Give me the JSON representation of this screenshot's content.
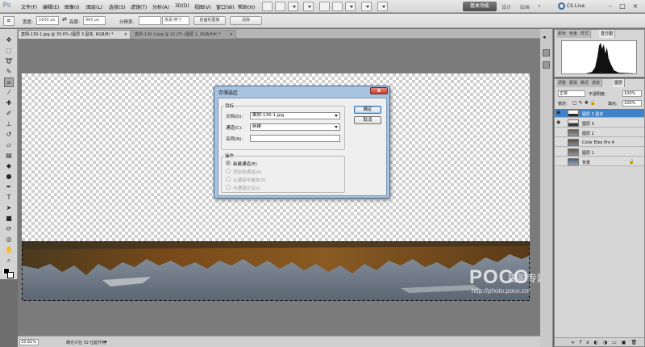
{
  "menubar": {
    "logo": "Ps",
    "items": [
      "文件(F)",
      "编辑(E)",
      "图像(I)",
      "图层(L)",
      "选择(S)",
      "滤镜(T)",
      "分析(A)",
      "3D(D)",
      "视图(V)",
      "窗口(W)",
      "帮助(H)"
    ],
    "workspace": {
      "active": "基本功能",
      "others": [
        "设计",
        "绘画"
      ]
    },
    "cs_live": "CS Live"
  },
  "options": {
    "width_label": "宽度:",
    "width_value": "1600 px",
    "height_label": "高度:",
    "height_value": "860 px",
    "resolution_label": "分辨率:",
    "unit_value": "像素/英寸",
    "front_image_button": "前面的图像",
    "clear_button": "清除"
  },
  "tabs": [
    {
      "label": "案例-130-1.jpg @ 33.6% (图层 3 副本, RGB/8) *",
      "close": "×",
      "active": true
    },
    {
      "label": "案例-130-2.jpg @ 22.2% (图层 1, RGB/8#) *",
      "close": "×",
      "active": false
    }
  ],
  "dialog": {
    "title": "存储选区",
    "close": "x",
    "target_group": "目标",
    "document_label": "文档(D):",
    "document_value": "案例-130-1.jpg",
    "channel_label": "通道(C):",
    "channel_value": "新建",
    "name_label": "名称(N):",
    "name_value": "",
    "ok": "确定",
    "cancel": "取消",
    "operation_group": "操作",
    "operations": [
      {
        "label": "新建通道(E)",
        "checked": true,
        "enabled": true
      },
      {
        "label": "添加到通道(A)",
        "checked": false,
        "enabled": false
      },
      {
        "label": "从通道中减去(S)",
        "checked": false,
        "enabled": false
      },
      {
        "label": "与通道交叉(I)",
        "checked": false,
        "enabled": false
      }
    ]
  },
  "status": {
    "zoom": "33.61%",
    "text": "曝光只在 32 位起作用"
  },
  "panels": {
    "top_tabs": [
      "颜色",
      "色板",
      "样式",
      "直方图"
    ],
    "layers_tabs": [
      "调整",
      "蒙版",
      "路径",
      "通道",
      "图层"
    ],
    "blend_mode": "正常",
    "opacity_label": "不透明度:",
    "opacity_value": "100%",
    "lock_label": "锁定:",
    "fill_label": "填充:",
    "fill_value": "100%",
    "layers": [
      {
        "name": "图层 3 副本",
        "selected": true
      },
      {
        "name": "图层 3",
        "selected": false
      },
      {
        "name": "图层 2",
        "selected": false
      },
      {
        "name": "Color Efex Pro 4",
        "selected": false
      },
      {
        "name": "图层 1",
        "selected": false
      },
      {
        "name": "背景",
        "selected": false
      }
    ]
  },
  "watermark": {
    "brand": "POCO",
    "subtitle": "摄影专题",
    "url": "http://photo.poco.cn/"
  },
  "colors": {
    "selected_layer": "#3e83c9",
    "dialog_frame": "#a7c3e0",
    "close_button": "#c2402c"
  }
}
